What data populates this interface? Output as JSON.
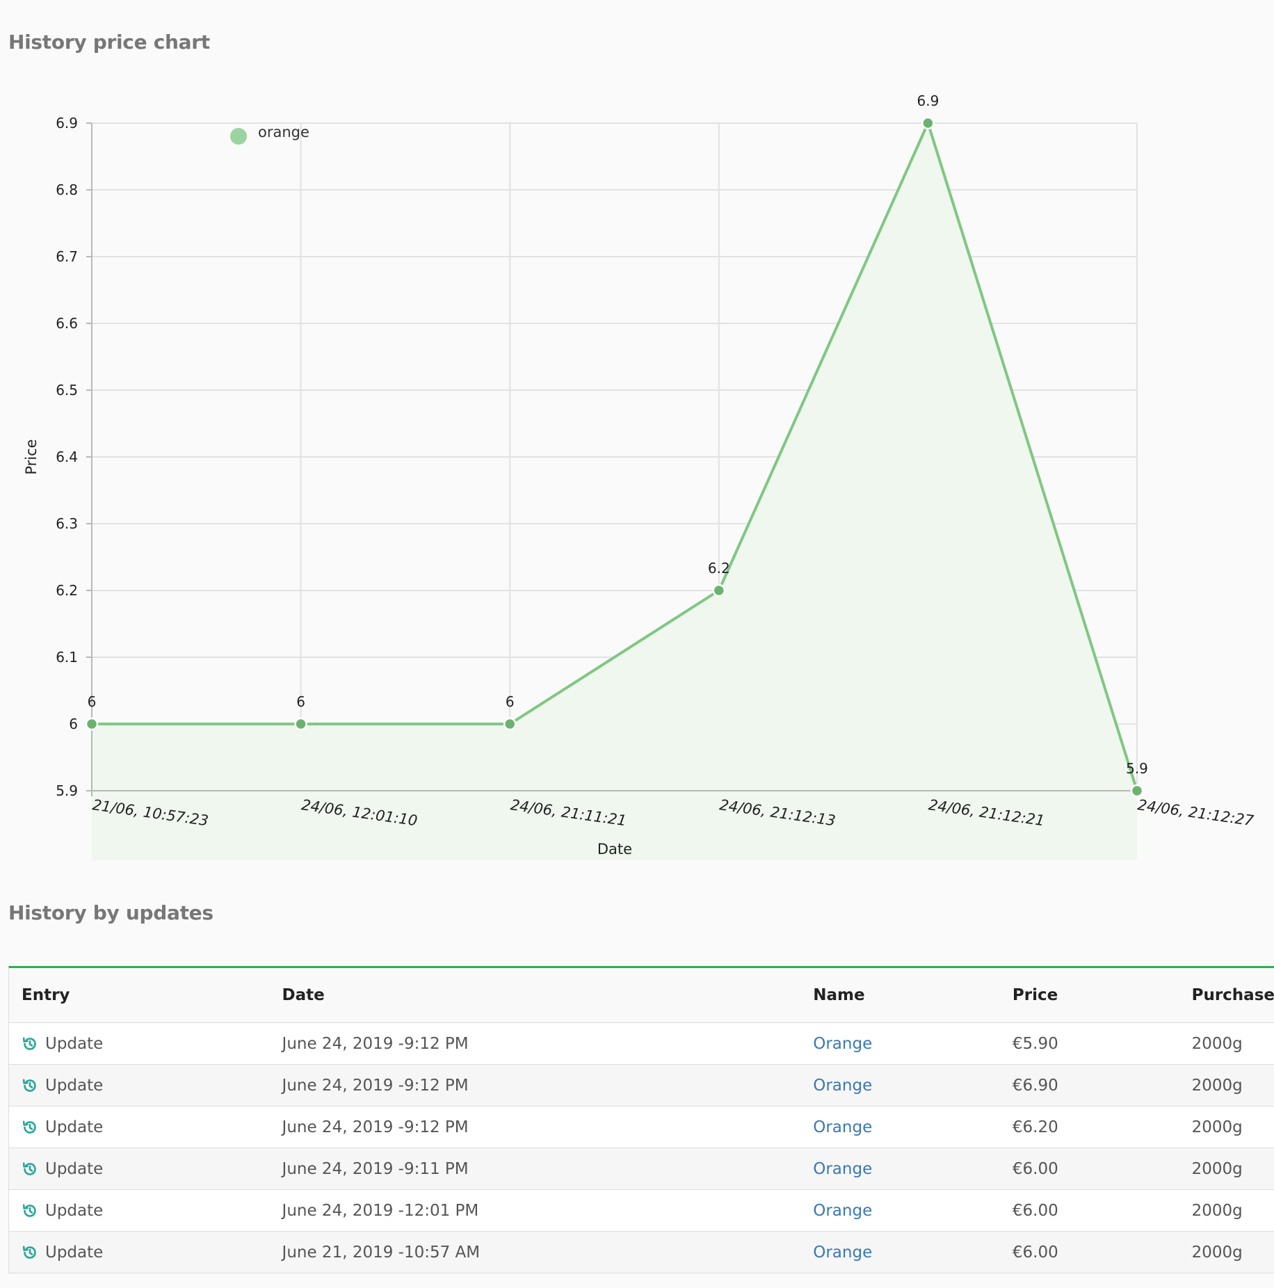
{
  "page": {
    "chart_title": "History price chart",
    "updates_title": "History by updates"
  },
  "chart_data": {
    "type": "area",
    "title": "",
    "xlabel": "Date",
    "ylabel": "Price",
    "x": [
      "21/06, 10:57:23",
      "24/06, 12:01:10",
      "24/06, 21:11:21",
      "24/06, 21:12:13",
      "24/06, 21:12:21",
      "24/06, 21:12:27"
    ],
    "series": [
      {
        "name": "orange",
        "values": [
          6,
          6,
          6,
          6.2,
          6.9,
          5.9
        ]
      }
    ],
    "data_labels": [
      "6",
      "6",
      "6",
      "6.2",
      "6.9",
      "5.9"
    ],
    "yticks": [
      "5.9",
      "6",
      "6.1",
      "6.2",
      "6.3",
      "6.4",
      "6.5",
      "6.6",
      "6.7",
      "6.8",
      "6.9"
    ],
    "ylim": [
      5.9,
      6.9
    ],
    "grid": true,
    "legend": "top-left",
    "colors": {
      "line": "#80c783",
      "fill": "#eff7ee",
      "point": "#6cb26f",
      "legend_dot": "#9bd4a0"
    }
  },
  "table": {
    "headers": [
      "Entry",
      "Date",
      "Name",
      "Price",
      "Purchase"
    ],
    "rows": [
      {
        "entry": "Update",
        "date": "June 24, 2019 -9:12 PM",
        "name": "Orange",
        "price": "€5.90",
        "purchase": "2000g"
      },
      {
        "entry": "Update",
        "date": "June 24, 2019 -9:12 PM",
        "name": "Orange",
        "price": "€6.90",
        "purchase": "2000g"
      },
      {
        "entry": "Update",
        "date": "June 24, 2019 -9:12 PM",
        "name": "Orange",
        "price": "€6.20",
        "purchase": "2000g"
      },
      {
        "entry": "Update",
        "date": "June 24, 2019 -9:11 PM",
        "name": "Orange",
        "price": "€6.00",
        "purchase": "2000g"
      },
      {
        "entry": "Update",
        "date": "June 24, 2019 -12:01 PM",
        "name": "Orange",
        "price": "€6.00",
        "purchase": "2000g"
      },
      {
        "entry": "Update",
        "date": "June 21, 2019 -10:57 AM",
        "name": "Orange",
        "price": "€6.00",
        "purchase": "2000g"
      }
    ],
    "entry_icon": "history-icon",
    "accent_color": "#2fae4e",
    "icon_color": "#26a69a",
    "link_color": "#3a78b5"
  }
}
